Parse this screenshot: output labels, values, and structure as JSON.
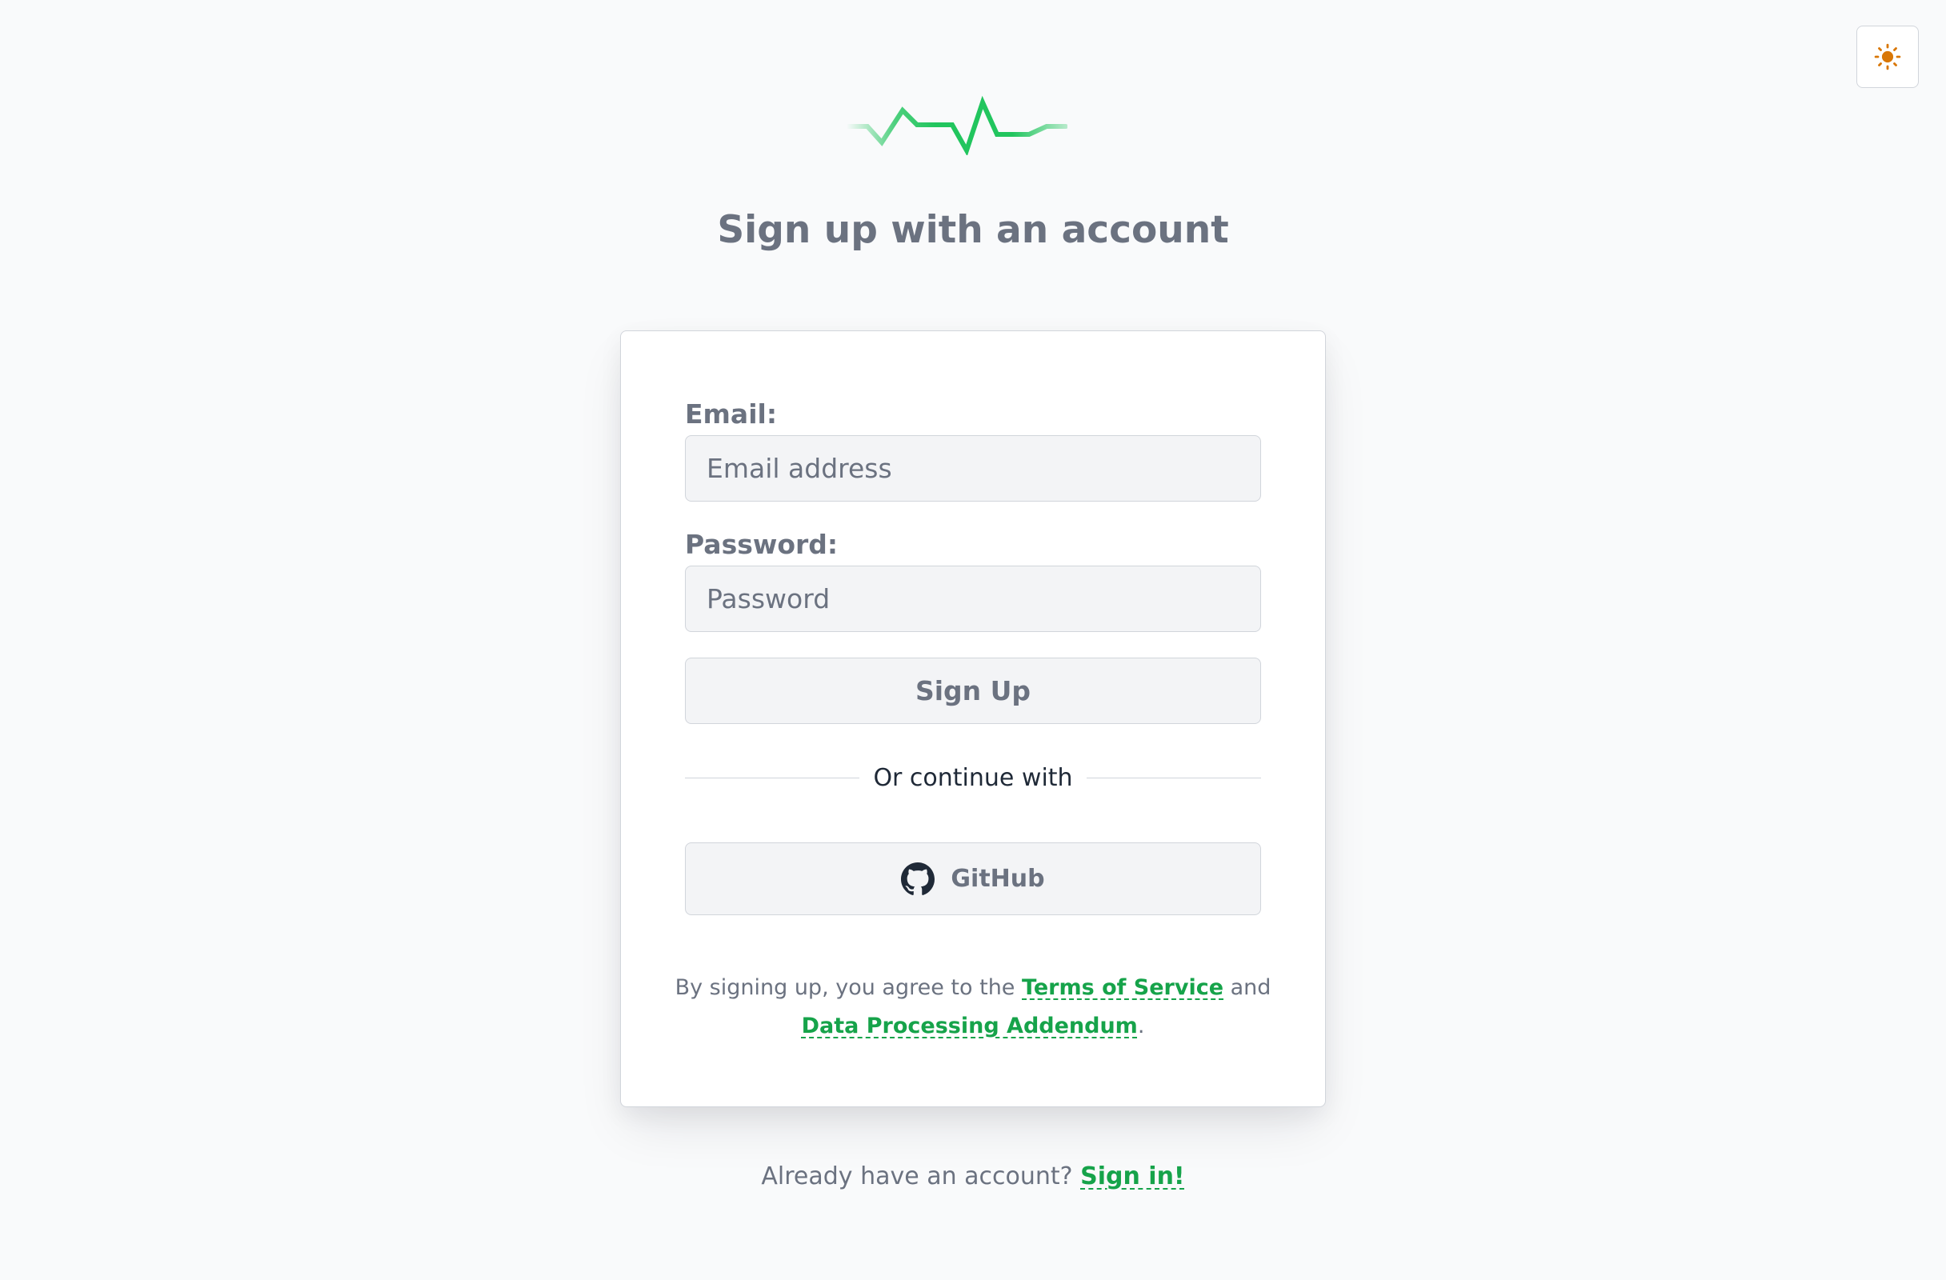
{
  "header": {
    "title": "Sign up with an account"
  },
  "theme_toggle": {
    "icon": "sun-icon",
    "color": "#d97706"
  },
  "form": {
    "email_label": "Email:",
    "email_placeholder": "Email address",
    "email_value": "",
    "password_label": "Password:",
    "password_placeholder": "Password",
    "password_value": "",
    "submit_label": "Sign Up",
    "divider_text": "Or continue with",
    "github_label": "GitHub",
    "github_icon": "github-icon"
  },
  "terms": {
    "prefix": "By signing up, you agree to the ",
    "tos_link": "Terms of Service",
    "middle": " and",
    "dpa_link": "Data Processing Addendum",
    "suffix": "."
  },
  "footer": {
    "prompt": "Already have an account? ",
    "signin_link": "Sign in!"
  },
  "colors": {
    "accent": "#16a34a",
    "logo": "#22c55e",
    "background": "#f9fafb"
  }
}
